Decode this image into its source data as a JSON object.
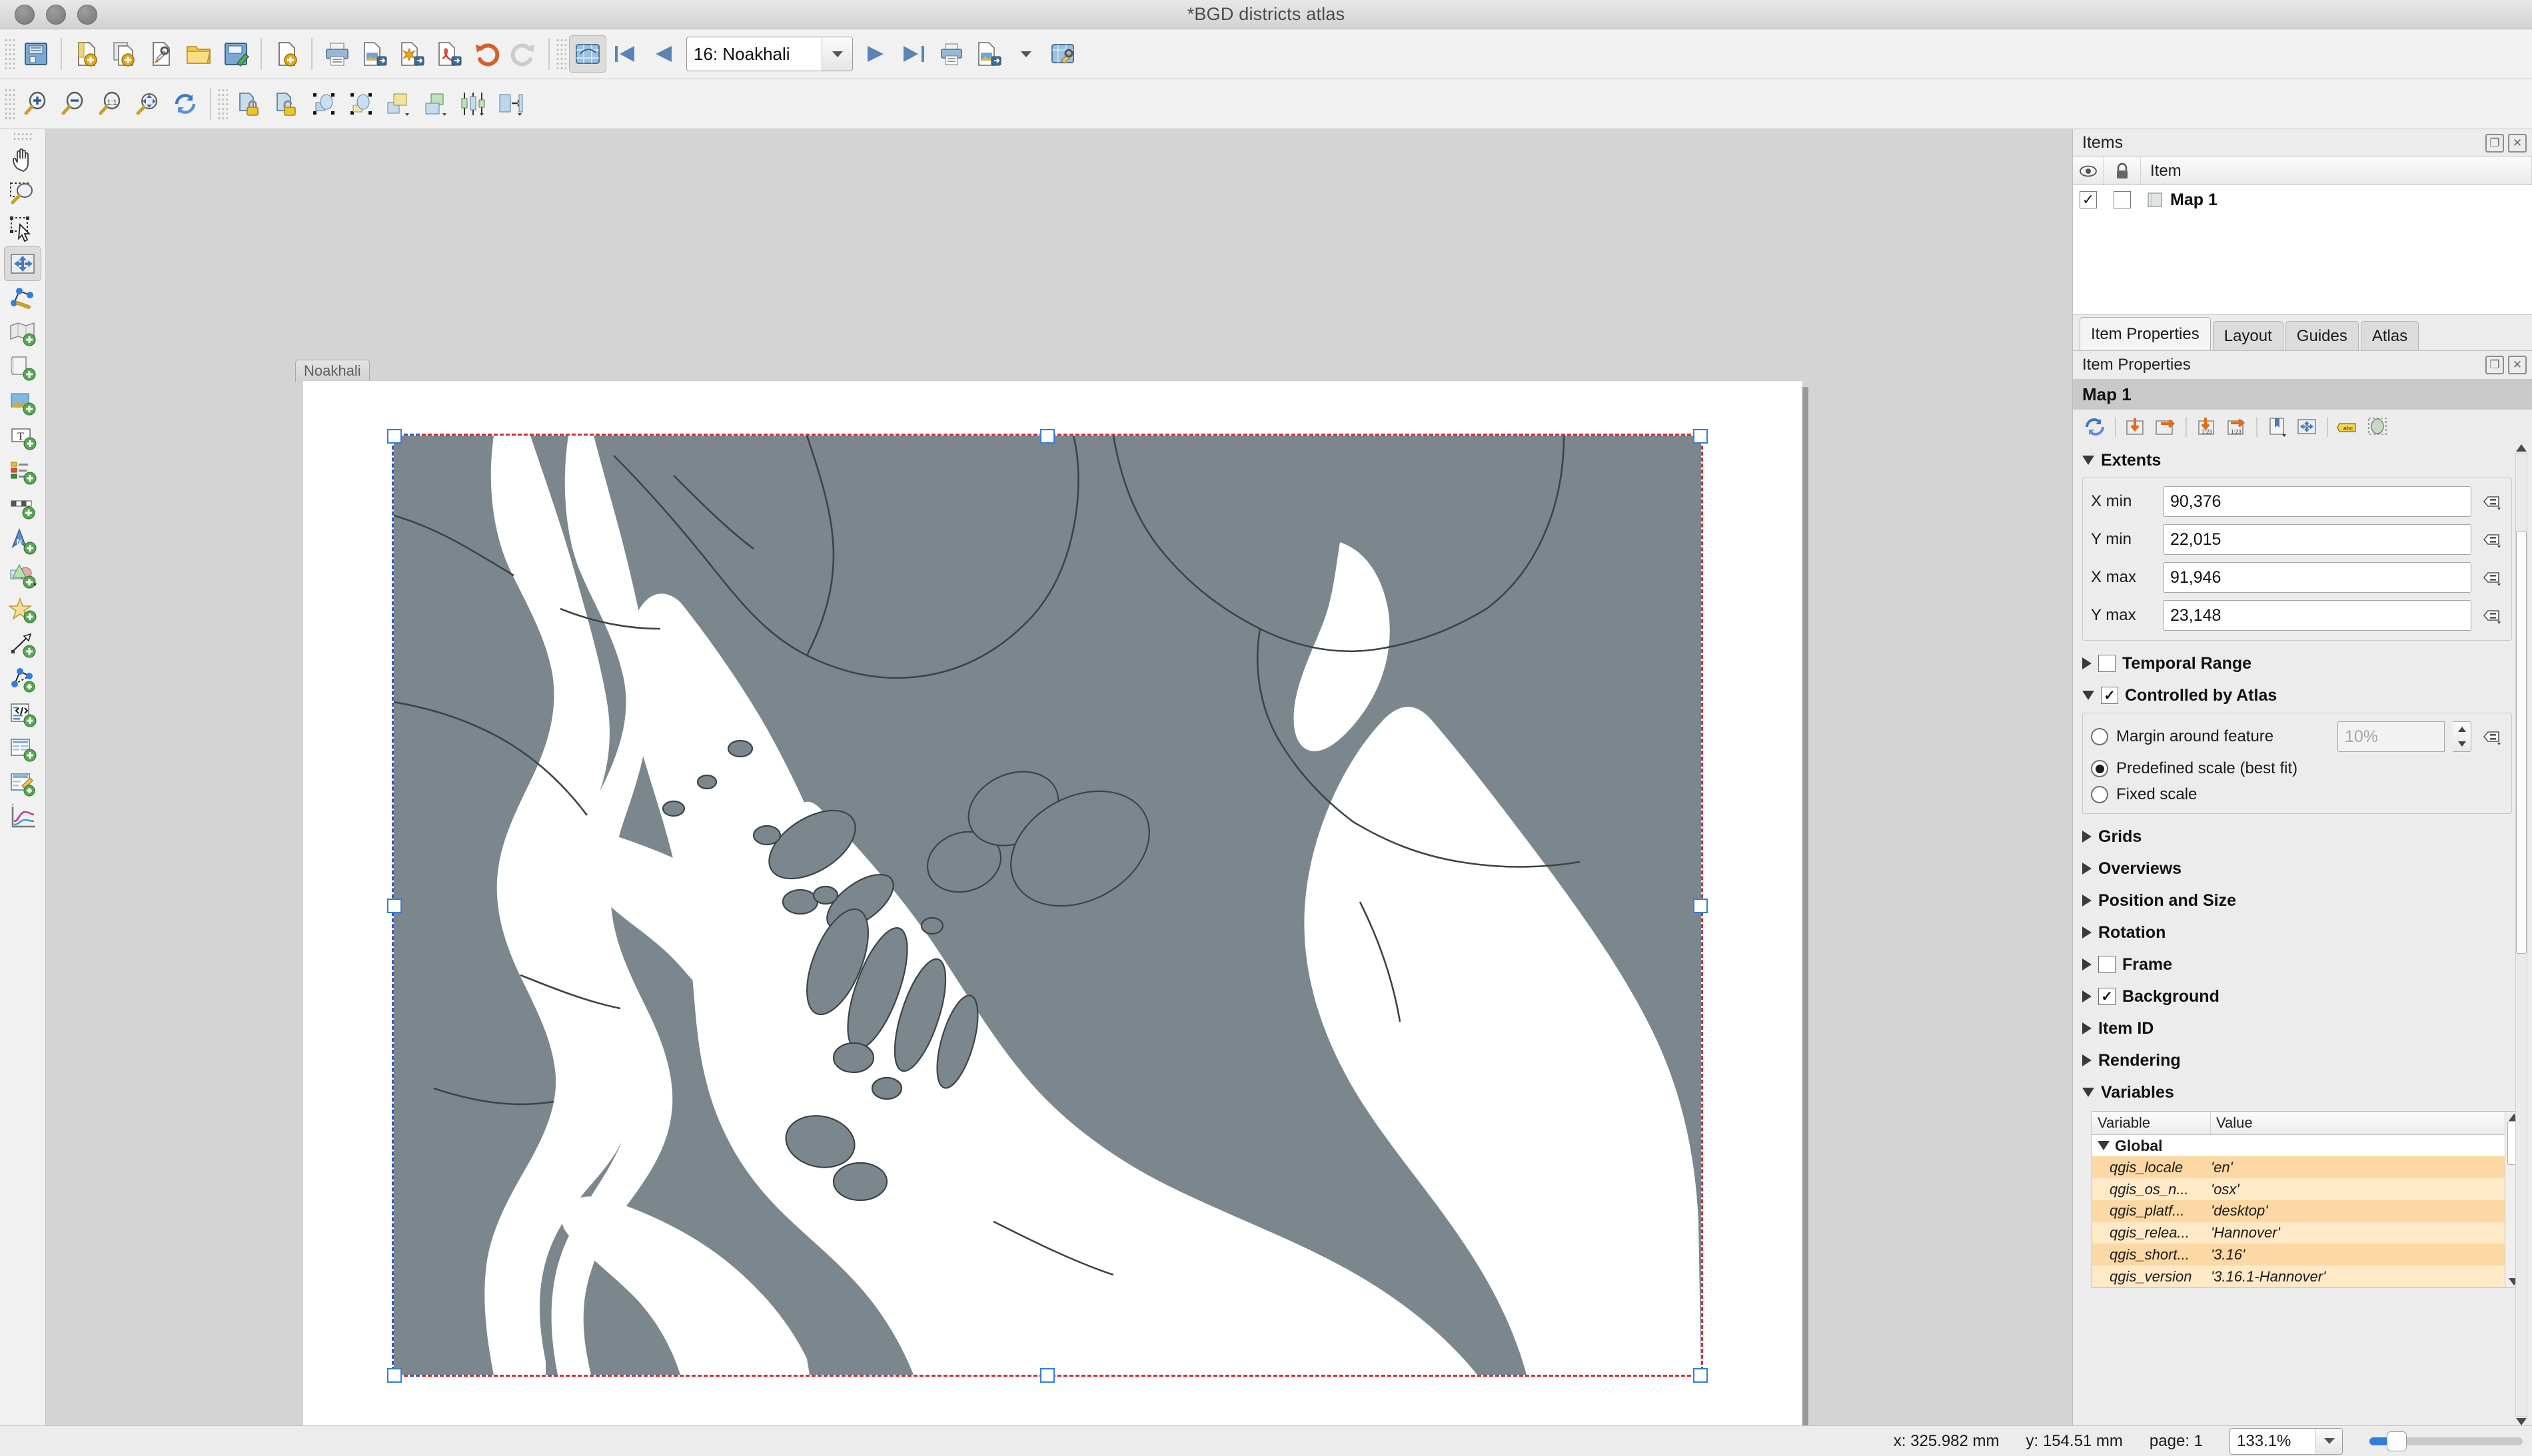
{
  "window": {
    "title": "*BGD districts atlas"
  },
  "toolbars": {
    "file": [
      {
        "name": "save-project-icon",
        "tip": "Save Project"
      },
      {
        "name": "new-layout-icon",
        "tip": "New Layout"
      },
      {
        "name": "duplicate-layout-icon",
        "tip": "Duplicate Layout"
      },
      {
        "name": "layout-manager-icon",
        "tip": "Layout Manager"
      },
      {
        "name": "open-template-icon",
        "tip": "Add Items from Template"
      },
      {
        "name": "save-template-icon",
        "tip": "Save as Template"
      },
      {
        "name": "new-report-icon",
        "tip": "New Report"
      },
      {
        "name": "print-icon",
        "tip": "Print Layout"
      },
      {
        "name": "export-image-icon",
        "tip": "Export as Image"
      },
      {
        "name": "export-svg-icon",
        "tip": "Export as SVG"
      },
      {
        "name": "export-pdf-icon",
        "tip": "Export as PDF"
      },
      {
        "name": "undo-icon",
        "tip": "Undo"
      },
      {
        "name": "redo-icon",
        "tip": "Redo"
      }
    ],
    "atlas": {
      "preview_label": "Preview Atlas",
      "first_label": "First Feature",
      "previous_label": "Previous Feature",
      "feature_value": "16: Noakhali",
      "next_label": "Next Feature",
      "last_label": "Last Feature",
      "print_label": "Print Atlas",
      "export_image_label": "Export Atlas as Image",
      "settings_label": "Atlas Settings"
    },
    "navigation": [
      {
        "name": "zoom-in-icon",
        "tip": "Zoom In"
      },
      {
        "name": "zoom-out-icon",
        "tip": "Zoom Out"
      },
      {
        "name": "zoom-100-icon",
        "tip": "Zoom to 100%"
      },
      {
        "name": "zoom-full-icon",
        "tip": "Zoom Full"
      },
      {
        "name": "refresh-icon",
        "tip": "Refresh View"
      },
      {
        "name": "lock-icon",
        "tip": "Lock Selected Items"
      },
      {
        "name": "unlock-icon",
        "tip": "Unlock All Items"
      },
      {
        "name": "group-icon",
        "tip": "Group Items"
      },
      {
        "name": "ungroup-icon",
        "tip": "Ungroup Items"
      },
      {
        "name": "raise-items-icon",
        "tip": "Raise Selected Items"
      },
      {
        "name": "lower-items-icon",
        "tip": "Lower Selected Items"
      },
      {
        "name": "align-items-icon",
        "tip": "Align Selected Items"
      },
      {
        "name": "distribute-items-icon",
        "tip": "Distribute Selected Items"
      }
    ],
    "tools": [
      {
        "name": "pan-layout-tool",
        "tip": "Pan Layout"
      },
      {
        "name": "zoom-tool",
        "tip": "Zoom"
      },
      {
        "name": "select-item-tool",
        "tip": "Select/Move Item"
      },
      {
        "name": "move-item-content-tool",
        "tip": "Move Item Content",
        "active": true
      },
      {
        "name": "edit-nodes-tool",
        "tip": "Edit Nodes Item"
      },
      {
        "name": "add-map-tool",
        "tip": "Add Map"
      },
      {
        "name": "add-picture-tool",
        "tip": "Add Picture"
      },
      {
        "name": "add-image-tool",
        "tip": "Add Image"
      },
      {
        "name": "add-label-tool",
        "tip": "Add Label"
      },
      {
        "name": "add-legend-tool",
        "tip": "Add Legend"
      },
      {
        "name": "add-scalebar-tool",
        "tip": "Add Scale Bar"
      },
      {
        "name": "add-north-arrow-tool",
        "tip": "Add North Arrow"
      },
      {
        "name": "add-shape-tool",
        "tip": "Add Shape"
      },
      {
        "name": "add-marker-tool",
        "tip": "Add Marker"
      },
      {
        "name": "add-arrow-tool",
        "tip": "Add Arrow"
      },
      {
        "name": "add-node-item-tool",
        "tip": "Add Node Item"
      },
      {
        "name": "add-html-tool",
        "tip": "Add HTML"
      },
      {
        "name": "add-attribute-table-tool",
        "tip": "Add Attribute Table"
      },
      {
        "name": "add-fixed-table-tool",
        "tip": "Add Fixed Table"
      },
      {
        "name": "add-plot-tool",
        "tip": "Add Plot"
      }
    ]
  },
  "canvas": {
    "page_label": "Noakhali",
    "land_color": "#7b878d",
    "water_color": "#ffffff",
    "boundary_color": "#3c4447"
  },
  "items_panel": {
    "title": "Items",
    "columns": {
      "visibility": "eye-icon",
      "lock": "lock-icon",
      "item": "Item"
    },
    "rows": [
      {
        "label": "Map 1",
        "visible": true,
        "locked": false
      }
    ]
  },
  "tabs": [
    {
      "label": "Item Properties",
      "active": true
    },
    {
      "label": "Layout",
      "active": false
    },
    {
      "label": "Guides",
      "active": false
    },
    {
      "label": "Atlas",
      "active": false
    }
  ],
  "item_properties": {
    "panel_title": "Item Properties",
    "item_title": "Map 1",
    "toolbar": [
      {
        "name": "update-preview-icon",
        "tip": "Update Map Preview"
      },
      {
        "name": "set-map-extent-to-canvas-icon",
        "tip": "Set Map Extent to Match Main Canvas Extent"
      },
      {
        "name": "set-canvas-to-map-extent-icon",
        "tip": "View Extent in Map Canvas"
      },
      {
        "name": "set-map-scale-to-canvas-icon",
        "tip": "Set Map Scale to Match Main Canvas Scale"
      },
      {
        "name": "set-canvas-scale-to-map-icon",
        "tip": "Set Main Canvas Scale to Match Map Scale"
      },
      {
        "name": "bookmarks-icon",
        "tip": "Bookmarks"
      },
      {
        "name": "interactive-edit-icon",
        "tip": "Interactively Edit Map Extent"
      },
      {
        "name": "labeling-icon",
        "tip": "Labeling Settings"
      },
      {
        "name": "clipping-icon",
        "tip": "Clipping Settings"
      }
    ],
    "sections": {
      "extents": {
        "label": "Extents",
        "expanded": true,
        "fields": [
          {
            "label": "X min",
            "value": "90,376",
            "name": "x-min-field"
          },
          {
            "label": "Y min",
            "value": "22,015",
            "name": "y-min-field"
          },
          {
            "label": "X max",
            "value": "91,946",
            "name": "x-max-field"
          },
          {
            "label": "Y max",
            "value": "23,148",
            "name": "y-max-field"
          }
        ]
      },
      "temporal_range": {
        "label": "Temporal Range",
        "expanded": false,
        "checked": false
      },
      "controlled_by_atlas": {
        "label": "Controlled by Atlas",
        "expanded": true,
        "checked": true,
        "options": [
          {
            "label": "Margin around feature",
            "selected": false,
            "value_placeholder": "10%"
          },
          {
            "label": "Predefined scale (best fit)",
            "selected": true
          },
          {
            "label": "Fixed scale",
            "selected": false
          }
        ]
      },
      "collapsed": [
        {
          "label": "Grids",
          "checkbox": null
        },
        {
          "label": "Overviews",
          "checkbox": null
        },
        {
          "label": "Position and Size",
          "checkbox": null
        },
        {
          "label": "Rotation",
          "checkbox": null
        },
        {
          "label": "Frame",
          "checkbox": false
        },
        {
          "label": "Background",
          "checkbox": true
        },
        {
          "label": "Item ID",
          "checkbox": null
        },
        {
          "label": "Rendering",
          "checkbox": null
        }
      ],
      "variables": {
        "label": "Variables",
        "expanded": true,
        "columns": [
          "Variable",
          "Value"
        ],
        "group": "Global",
        "rows": [
          {
            "variable": "qgis_locale",
            "value": "'en'"
          },
          {
            "variable": "qgis_os_n...",
            "value": "'osx'"
          },
          {
            "variable": "qgis_platf...",
            "value": "'desktop'"
          },
          {
            "variable": "qgis_relea...",
            "value": "'Hannover'"
          },
          {
            "variable": "qgis_short...",
            "value": "'3.16'"
          },
          {
            "variable": "qgis_version",
            "value": "'3.16.1-Hannover'"
          }
        ]
      }
    }
  },
  "status_bar": {
    "x": "x: 325.982 mm",
    "y": "y: 154.51 mm",
    "page": "page: 1",
    "zoom": "133.1%"
  }
}
